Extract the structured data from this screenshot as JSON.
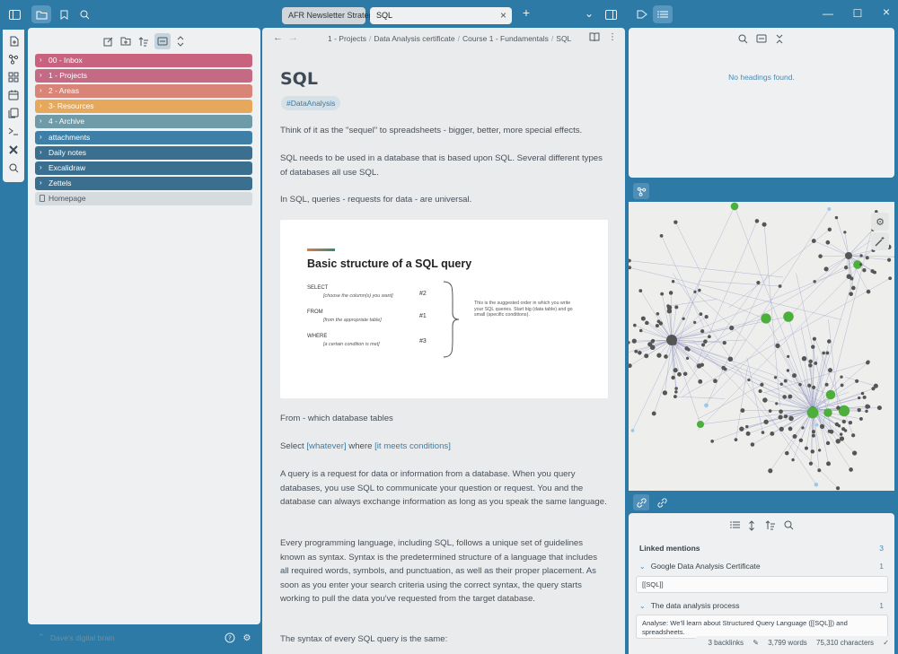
{
  "titlebar": {
    "tabs": [
      {
        "label": "AFR Newsletter Strategy",
        "active": false
      },
      {
        "label": "SQL",
        "active": true
      }
    ],
    "new_tab": "+",
    "close_tab": "×"
  },
  "explorer": {
    "folders": [
      {
        "label": "00 - Inbox",
        "color": "#c8627e"
      },
      {
        "label": "1 - Projects",
        "color": "#c46a85"
      },
      {
        "label": "2 - Areas",
        "color": "#d88477"
      },
      {
        "label": "3- Resources",
        "color": "#e5a85c"
      },
      {
        "label": "4 - Archive",
        "color": "#6f9aa7"
      },
      {
        "label": "attachments",
        "color": "#3e7fa7"
      },
      {
        "label": "Daily notes",
        "color": "#3b6f8f"
      },
      {
        "label": "Excalidraw",
        "color": "#3b6f8f"
      },
      {
        "label": "Zettels",
        "color": "#3b6f8f"
      }
    ],
    "files": [
      {
        "label": "Homepage"
      }
    ],
    "vault_name": "Dave's digital brain"
  },
  "editor": {
    "breadcrumb": [
      "1 - Projects",
      "Data Analysis certificate",
      "Course 1 - Fundamentals",
      "SQL"
    ],
    "title": "SQL",
    "tag": "#DataAnalysis",
    "p1": "Think of it as the \"sequel\" to spreadsheets - bigger, better, more special effects.",
    "p2": "SQL needs to be used in a database that is based upon SQL. Several different types of databases all use SQL.",
    "p3": "In SQL, queries - requests for data - are universal.",
    "figure": {
      "title": "Basic structure of a SQL query",
      "rows": [
        {
          "kw": "SELECT",
          "sub": "[choose the column(s) you want]",
          "num": "#2"
        },
        {
          "kw": "FROM",
          "sub": "[from the appropriate table]",
          "num": "#1"
        },
        {
          "kw": "WHERE",
          "sub": "[a certain condition is met]",
          "num": "#3"
        }
      ],
      "note": "This is the suggested order in which you write your SQL queries. Start big (data table) and go small (specific conditions)."
    },
    "p4": "From - which database tables",
    "p5_a": "Select ",
    "p5_link1": "[whatever]",
    "p5_b": " where ",
    "p5_link2": "[it meets conditions]",
    "p6": "A query is a request for data or information from a database. When you query databases, you use SQL to communicate your question or request. You and the database can always exchange information as long as you speak the same language.",
    "p7": "Every programming language, including SQL, follows a unique set of guidelines known as syntax. Syntax is the predetermined structure of a language that includes all required words, symbols, and punctuation, as well as their proper placement. As soon as you enter your search criteria using the correct syntax, the query starts working to pull the data you've requested from the target database.",
    "p8": "The syntax of every SQL query is the same:"
  },
  "outline": {
    "empty_text": "No headings found."
  },
  "backlinks": {
    "linked_mentions_label": "Linked mentions",
    "linked_mentions_count": "3",
    "sources": [
      {
        "title": "Google Data Analysis Certificate",
        "count": "1",
        "snippet": "[[SQL]]"
      },
      {
        "title": "The data analysis process",
        "count": "1",
        "snippet": "Analyse:  We'll learn about Structured Query Language ([[SQL]]) and spreadsheets."
      }
    ]
  },
  "status": {
    "backlinks": "3 backlinks",
    "words": "3,799 words",
    "characters": "75,310 characters"
  }
}
